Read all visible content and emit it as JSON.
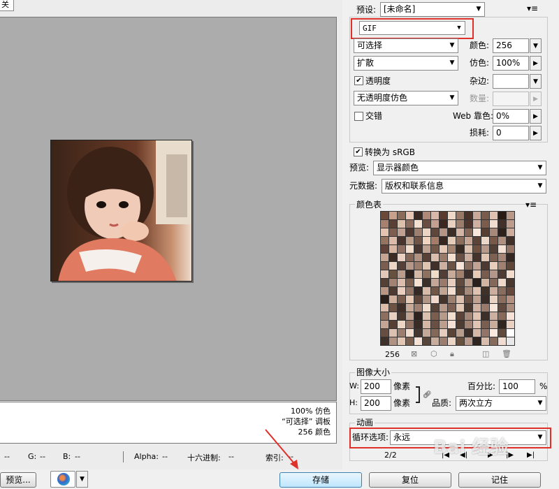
{
  "left": {
    "tab_label": "关",
    "info": {
      "line1": "100% 仿色",
      "line2": "“可选择” 调板",
      "line3": "256 颜色"
    },
    "status": {
      "r": "--",
      "g_label": "G:",
      "g": "--",
      "b_label": "B:",
      "b": "--",
      "alpha_label": "Alpha:",
      "alpha": "--",
      "hex_label": "十六进制:",
      "hex": "--",
      "index_label": "索引:",
      "index": "--"
    }
  },
  "preset": {
    "label": "预设:",
    "value": "[未命名]"
  },
  "format": {
    "value": "GIF"
  },
  "reduction": {
    "value": "可选择"
  },
  "colors": {
    "label": "颜色:",
    "value": "256"
  },
  "dither_algo": {
    "value": "扩散"
  },
  "dither": {
    "label": "仿色:",
    "value": "100%"
  },
  "transparency": {
    "label": "透明度",
    "checked": true
  },
  "matte": {
    "label": "杂边:",
    "value": ""
  },
  "trans_dither": {
    "value": "无透明度仿色"
  },
  "amount": {
    "label": "数量:",
    "value": ""
  },
  "interlaced": {
    "label": "交错",
    "checked": false
  },
  "web_snap": {
    "label": "Web 靠色:",
    "value": "0%"
  },
  "lossy": {
    "label": "损耗:",
    "value": "0"
  },
  "convert_srgb": {
    "label": "转换为 sRGB",
    "checked": true
  },
  "preview": {
    "label": "预览:",
    "value": "显示器颜色"
  },
  "metadata": {
    "label": "元数据:",
    "value": "版权和联系信息"
  },
  "color_table": {
    "title": "颜色表",
    "count": "256",
    "swatches": [
      "#6b4a3a",
      "#c9a08a",
      "#8a6a58",
      "#e8c8b4",
      "#3a2a22",
      "#b08878",
      "#d8b8a8",
      "#5a3a2e",
      "#f0d8c8",
      "#9a7866",
      "#4a3228",
      "#c8a898",
      "#7a5a4a",
      "#e0c0b0",
      "#2a1a14",
      "#b89888",
      "#a88070",
      "#5a4034",
      "#dcc0ac",
      "#8c6c5c",
      "#f4e0d0",
      "#6a4c40",
      "#c4a090",
      "#3c2820",
      "#e8d0c0",
      "#9c7c6c",
      "#50362c",
      "#d0b0a0",
      "#7c5c4c",
      "#f0dcd0",
      "#44302a",
      "#bc9c8c",
      "#e4c4b0",
      "#7e5e4e",
      "#c0a090",
      "#4e3830",
      "#9e7e6e",
      "#ecd4c4",
      "#60463a",
      "#b49484",
      "#3e2c26",
      "#d4b4a4",
      "#846454",
      "#f8e8dc",
      "#563e32",
      "#a88878",
      "#2e201a",
      "#ccac9c",
      "#94745e",
      "#dcbca8",
      "#48342c",
      "#bca08c",
      "#705446",
      "#f0d4c0",
      "#a47c68",
      "#382620",
      "#e4ccb8",
      "#8c6c5a",
      "#c8a694",
      "#5c4438",
      "#ecd8c8",
      "#7a5848",
      "#b09080",
      "#403028",
      "#604238",
      "#d8b6a2",
      "#8e6e60",
      "#f2dccc",
      "#4a3630",
      "#c0a292",
      "#74584a",
      "#e6c8b6",
      "#a4846e",
      "#3a2a24",
      "#dec2b0",
      "#6e5040",
      "#b89a8a",
      "#524036",
      "#f6e2d4",
      "#947464",
      "#c6a492",
      "#3c2c24",
      "#ead0c0",
      "#846656",
      "#b29282",
      "#584036",
      "#dcbeac",
      "#9a7a68",
      "#f4dece",
      "#6a5042",
      "#ccae9e",
      "#46342c",
      "#e2c6b4",
      "#7e6050",
      "#a68676",
      "#342620",
      "#7c5e50",
      "#eed6c6",
      "#56403a",
      "#b69888",
      "#9c7c6a",
      "#e0c4b2",
      "#403028",
      "#ceb0a0",
      "#6c5244",
      "#f8e4d6",
      "#8a6c5c",
      "#c2a494",
      "#4c3a32",
      "#e8ceba",
      "#a08070",
      "#5e4638",
      "#e2c8b8",
      "#68503e",
      "#ba9c8c",
      "#302420",
      "#d6b8a6",
      "#8e705e",
      "#f0dac8",
      "#523e34",
      "#c8aa98",
      "#a2806e",
      "#3e302a",
      "#e6cab8",
      "#7a5c4e",
      "#b4968a",
      "#4e3c34",
      "#f2dcce",
      "#544034",
      "#a48272",
      "#dcbcaa",
      "#7e6050",
      "#f6e0d2",
      "#3c2e28",
      "#c4a696",
      "#9a7a6a",
      "#e8ccbc",
      "#624a3c",
      "#b89a88",
      "#2c201c",
      "#d2b4a2",
      "#86685a",
      "#eed8ca",
      "#483830",
      "#b89684",
      "#4e3a30",
      "#eacfbe",
      "#947666",
      "#362824",
      "#d8baa8",
      "#725646",
      "#c2a492",
      "#f4decf",
      "#5a4436",
      "#a88a7a",
      "#e0c2b0",
      "#403228",
      "#cdae9c",
      "#8a6c5e",
      "#64483c",
      "#2a1e1a",
      "#cfae9c",
      "#7a5c4c",
      "#e6cab6",
      "#5e463a",
      "#b49686",
      "#f0d8ca",
      "#44342c",
      "#9e806e",
      "#dec0ae",
      "#6c5244",
      "#c0a290",
      "#3a2c26",
      "#ead2c2",
      "#8c6e5e",
      "#b49080",
      "#dabca8",
      "#6e5244",
      "#3e2e26",
      "#c8aa98",
      "#a08070",
      "#f2dccc",
      "#564236",
      "#b89a8a",
      "#7e6052",
      "#e4c8b6",
      "#48382e",
      "#cfb2a2",
      "#9a7a6a",
      "#f8e6da",
      "#624a3e",
      "#aa8c7c",
      "#8e6e5e",
      "#e8d0c0",
      "#4c3a30",
      "#c0a292",
      "#2e221e",
      "#dcc0ae",
      "#7c5e4e",
      "#b69a8a",
      "#f2dece",
      "#5c4438",
      "#a48676",
      "#e2c4b2",
      "#3c2e28",
      "#cdb0a0",
      "#88695a",
      "#f6e2d6",
      "#c4a494",
      "#564034",
      "#eed6c4",
      "#927262",
      "#3a2c24",
      "#d6b6a4",
      "#6a5042",
      "#bc9e8e",
      "#f4e0d4",
      "#4e3c32",
      "#a28272",
      "#e0c4b4",
      "#7a5e50",
      "#caac9c",
      "#302620",
      "#e8d0c2",
      "#684e40",
      "#dcc0b0",
      "#9c7e6e",
      "#f0dccc",
      "#463630",
      "#c6a898",
      "#846858",
      "#e6ccbc",
      "#5a4436",
      "#b89c8c",
      "#3e3028",
      "#d4b8a8",
      "#92746a",
      "#f8e8de",
      "#604a3c",
      "#ffffff",
      "#40302a",
      "#b09282",
      "#e4c6b4",
      "#7a5e4e",
      "#f4e2d6",
      "#564438",
      "#c8ac9c",
      "#9c7e70",
      "#ecd4c6",
      "#68503e",
      "#b89a8c",
      "#2e2420",
      "#d8bcac",
      "#866a5c",
      "#f0dcd0",
      "#e8e8e8"
    ]
  },
  "image_size": {
    "title": "图像大小",
    "w_label": "W:",
    "w": "200",
    "w_unit": "像素",
    "h_label": "H:",
    "h": "200",
    "h_unit": "像素",
    "percent_label": "百分比:",
    "percent": "100",
    "percent_unit": "%",
    "quality_label": "品质:",
    "quality": "两次立方"
  },
  "animation": {
    "title": "动画",
    "loop_label": "循环选项:",
    "loop": "永远",
    "frame": "2/2"
  },
  "buttons": {
    "preview": "预览...",
    "save": "存储",
    "reset": "复位",
    "remember": "记住"
  },
  "watermark": {
    "text": "Bai 经验"
  },
  "colors_ui": {
    "highlight": "#e0302a",
    "canvas": "#acacac"
  }
}
